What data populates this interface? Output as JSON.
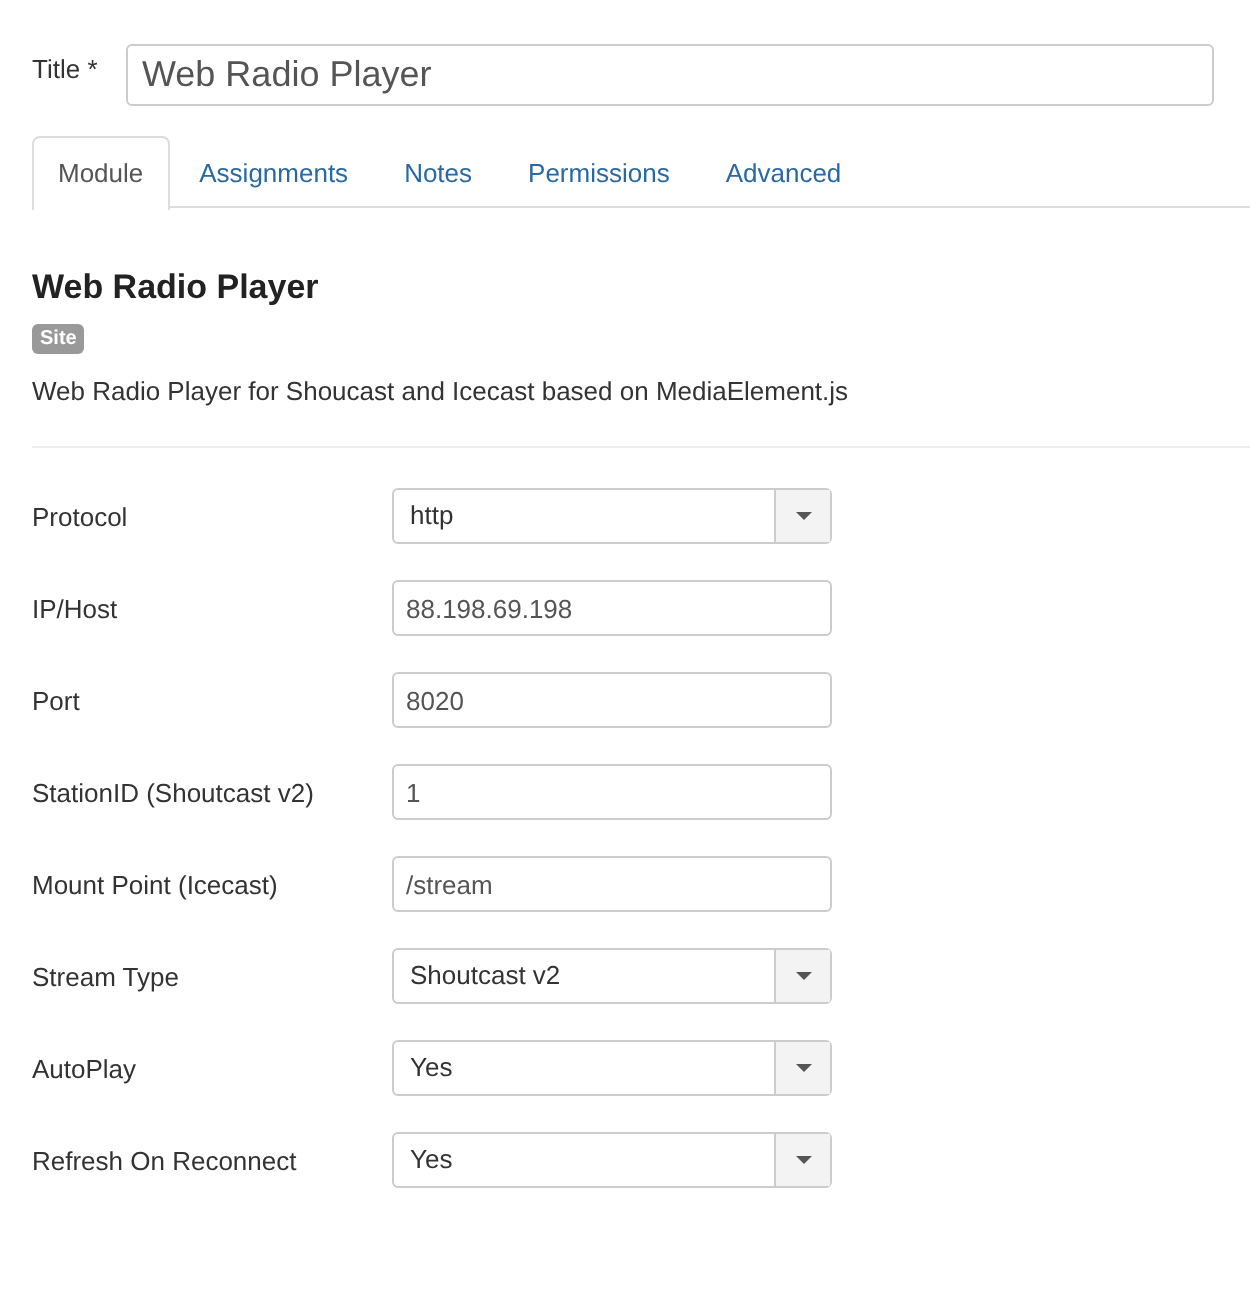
{
  "title_field": {
    "label": "Title *",
    "value": "Web Radio Player"
  },
  "tabs": [
    {
      "label": "Module",
      "selected": true
    },
    {
      "label": "Assignments",
      "selected": false
    },
    {
      "label": "Notes",
      "selected": false
    },
    {
      "label": "Permissions",
      "selected": false
    },
    {
      "label": "Advanced",
      "selected": false
    }
  ],
  "module": {
    "heading": "Web Radio Player",
    "badge": "Site",
    "description": "Web Radio Player for Shoucast and Icecast based on MediaElement.js"
  },
  "fields": [
    {
      "label": "Protocol",
      "kind": "select",
      "value": "http"
    },
    {
      "label": "IP/Host",
      "kind": "text",
      "value": "88.198.69.198"
    },
    {
      "label": "Port",
      "kind": "text",
      "value": "8020"
    },
    {
      "label": "StationID (Shoutcast v2)",
      "kind": "text",
      "value": "1"
    },
    {
      "label": "Mount Point (Icecast)",
      "kind": "text",
      "value": "/stream"
    },
    {
      "label": "Stream Type",
      "kind": "select",
      "value": "Shoutcast v2"
    },
    {
      "label": "AutoPlay",
      "kind": "select",
      "value": "Yes"
    },
    {
      "label": "Refresh On Reconnect",
      "kind": "select",
      "value": "Yes"
    }
  ]
}
